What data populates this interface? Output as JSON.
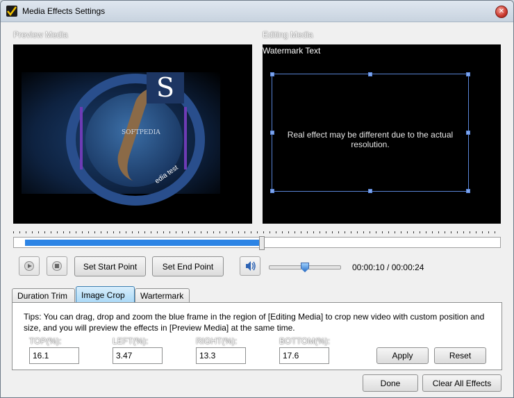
{
  "window": {
    "title": "Media Effects Settings",
    "close_glyph": "✕"
  },
  "sections": {
    "preview_label": "Preview Media",
    "editing_label": "Editing Media"
  },
  "preview": {
    "image_text": "SOFTPEDIA",
    "image_subtext": "edia test",
    "logo_letter": "S"
  },
  "editing": {
    "watermark_label": "Watermark Text",
    "crop_note": "Real effect may be different due to the actual resolution."
  },
  "timeline": {
    "progress_fraction": 0.4167
  },
  "controls": {
    "play_icon": "play-icon",
    "stop_icon": "stop-icon",
    "set_start_label": "Set Start Point",
    "set_end_label": "Set End Point",
    "volume_icon": "speaker-icon",
    "volume_fraction": 0.5,
    "time_current": "00:00:10",
    "time_separator": " / ",
    "time_total": "00:00:24"
  },
  "tabs": [
    {
      "label": "Duration Trim",
      "active": false
    },
    {
      "label": "Image Crop",
      "active": true
    },
    {
      "label": "Wartermark",
      "active": false
    }
  ],
  "crop": {
    "tips": "Tips: You can drag, drop and zoom the blue frame in the region of [Editing Media] to crop new video with custom position and size, and you will preview the effects in [Preview Media] at the same time.",
    "fields": [
      {
        "label": "TOP(%):",
        "value": "16.1"
      },
      {
        "label": "LEFT(%):",
        "value": "3.47"
      },
      {
        "label": "RIGHT(%):",
        "value": "13.3"
      },
      {
        "label": "BOTTOM(%):",
        "value": "17.6"
      }
    ],
    "apply_label": "Apply",
    "reset_label": "Reset"
  },
  "footer": {
    "done_label": "Done",
    "clear_label": "Clear All Effects"
  },
  "colors": {
    "accent_blue": "#2c84e5",
    "crop_frame": "#5a86d8",
    "active_tab": "#a9d8f6"
  }
}
